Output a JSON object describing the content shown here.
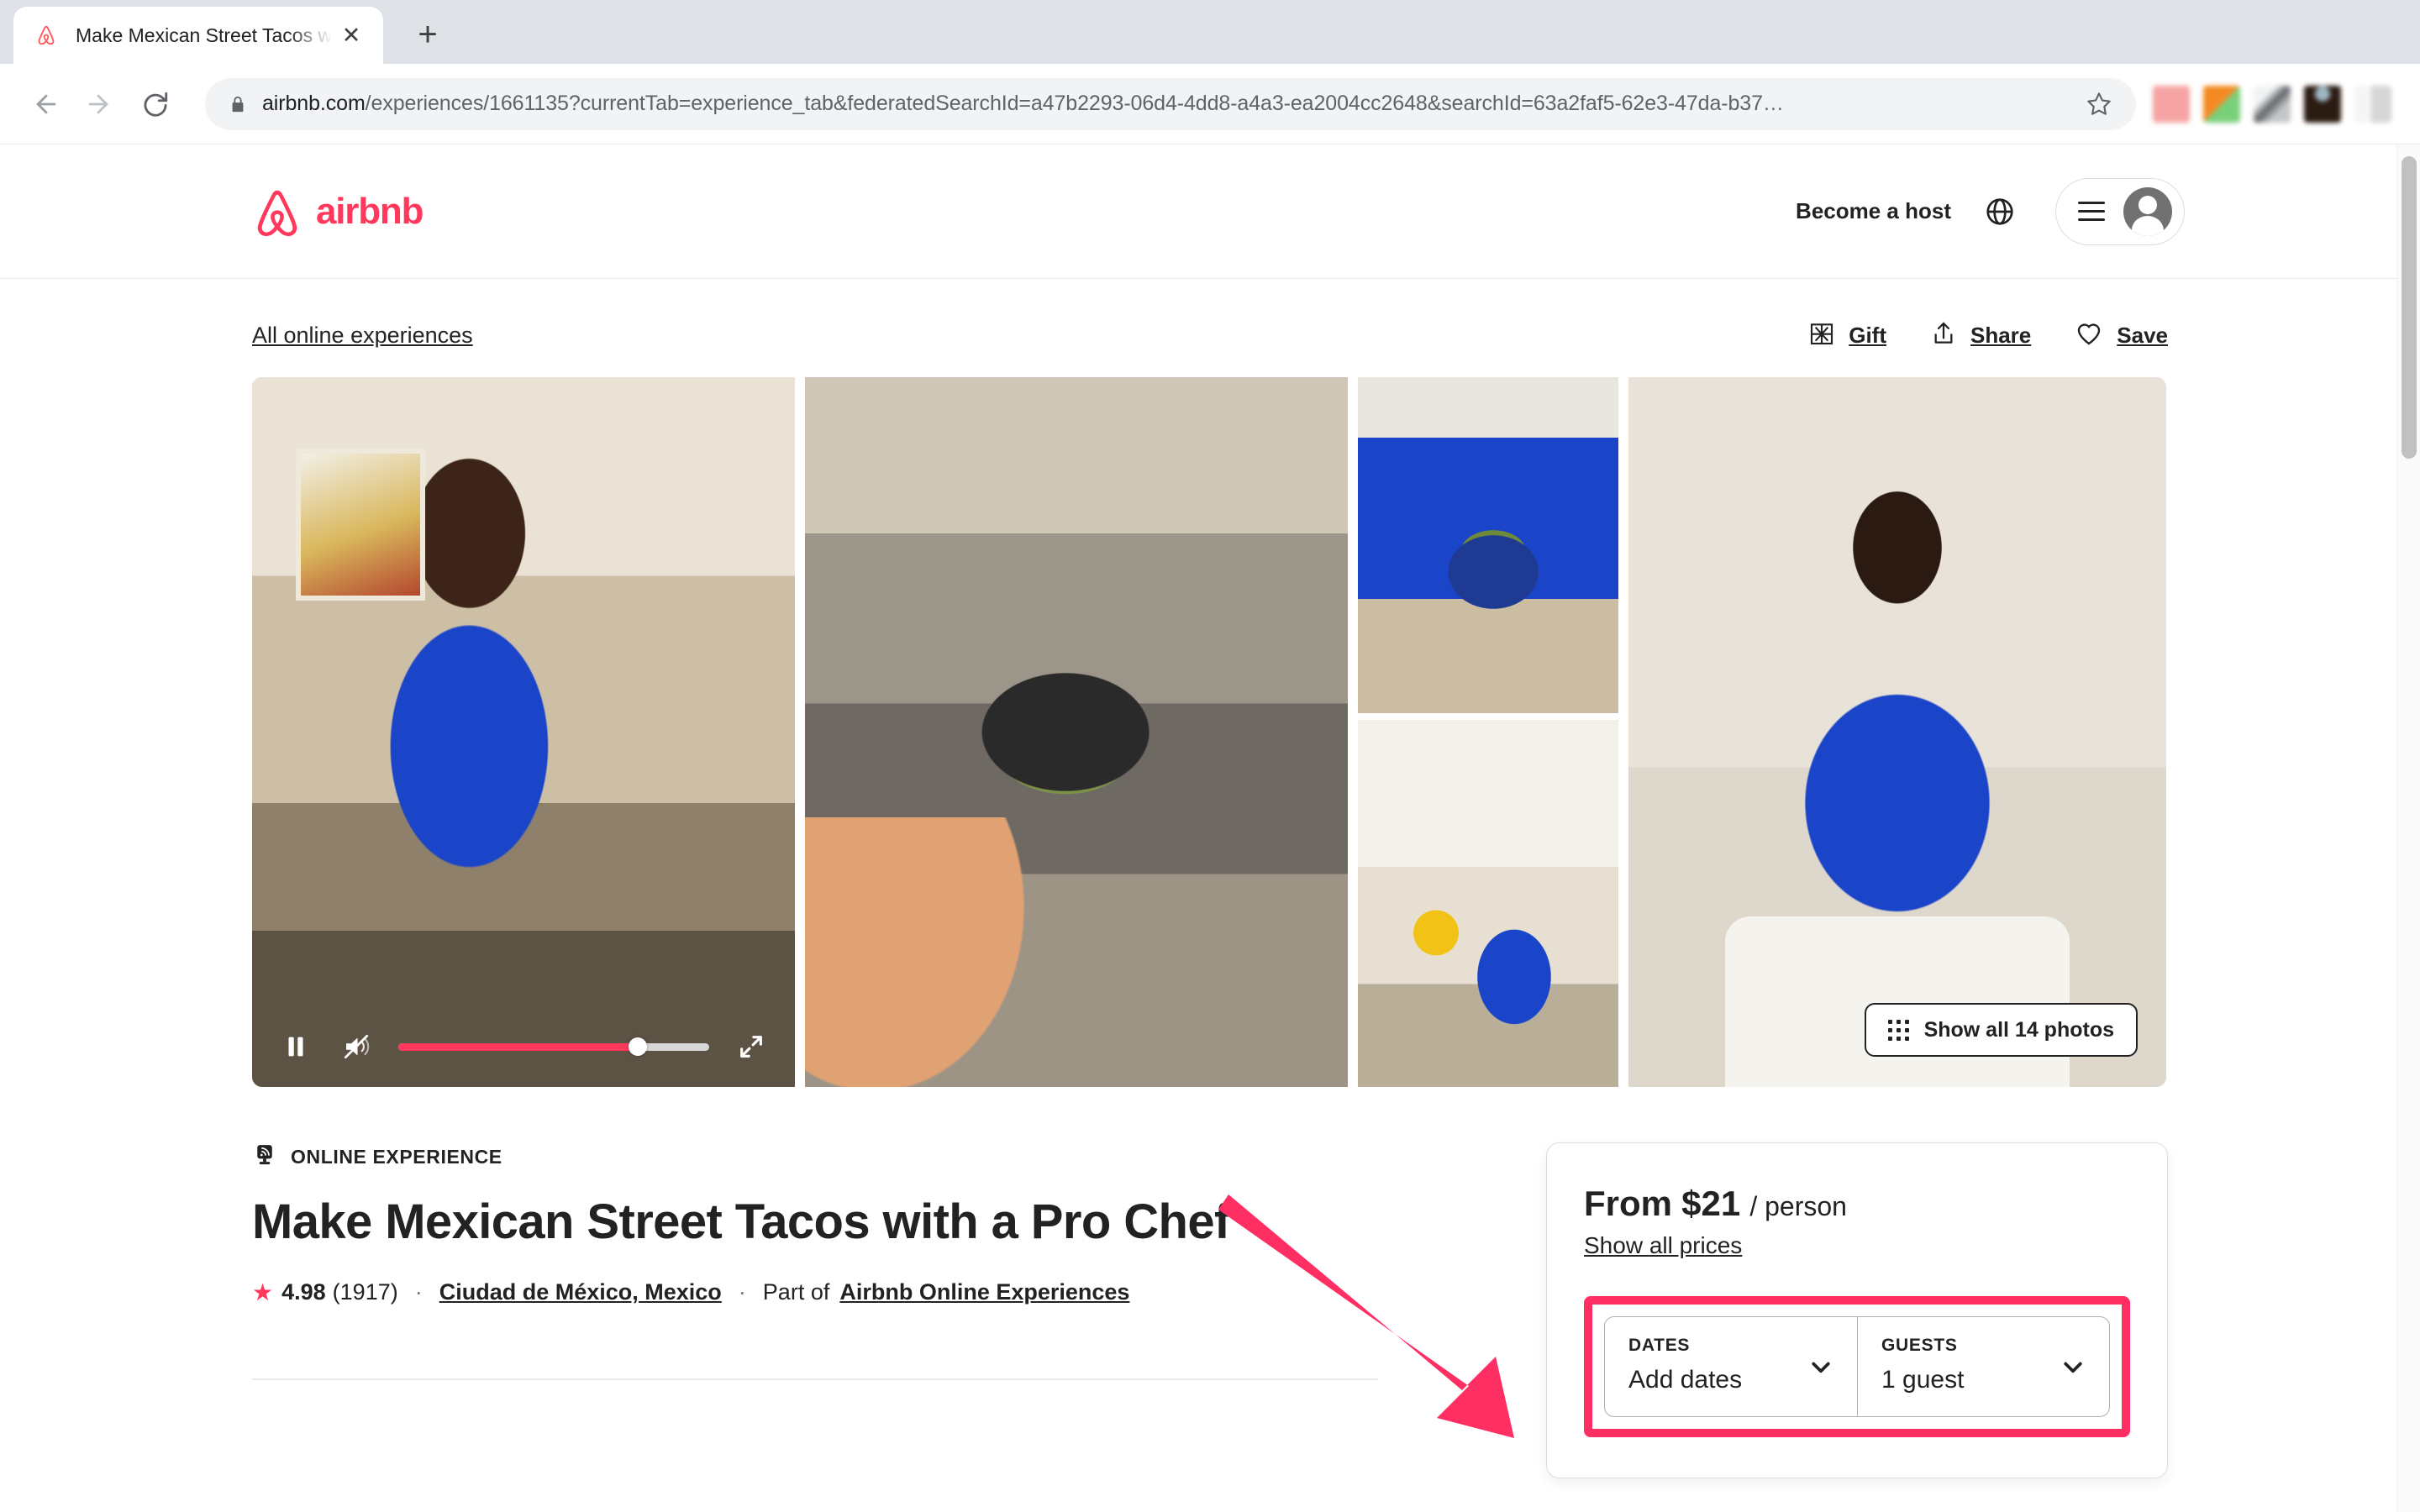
{
  "browser": {
    "tab": {
      "title": "Make Mexican Street Tacos wit",
      "favicon": "airbnb-favicon",
      "close_label": "✕"
    },
    "new_tab_label": "+",
    "nav": {
      "back": "←",
      "forward": "→",
      "reload": "↻"
    },
    "omnibox": {
      "host": "airbnb.com",
      "path": "/experiences/1661135?currentTab=experience_tab&federatedSearchId=a47b2293-06d4-4dd8-a4a3-ea2004cc2648&searchId=63a2faf5-62e3-47da-b37…",
      "lock": "lock-icon",
      "bookmark": "star-icon"
    }
  },
  "site_header": {
    "brand": "airbnb",
    "become_host": "Become a host",
    "globe": "globe-icon",
    "menu": "hamburger-icon",
    "avatar": "user-avatar"
  },
  "utility_row": {
    "breadcrumb": "All online experiences",
    "actions": [
      {
        "label": "Gift",
        "icon": "gift-icon"
      },
      {
        "label": "Share",
        "icon": "share-icon"
      },
      {
        "label": "Save",
        "icon": "heart-icon"
      }
    ]
  },
  "gallery": {
    "show_all_label": "Show all 14 photos",
    "show_all_icon": "grid-icon",
    "video_controls": {
      "play_pause": "pause-icon",
      "mute": "muted-volume-icon",
      "fullscreen": "expand-icon",
      "progress_percent": 77
    },
    "photos": [
      {
        "alt": "Chef cooking in kitchen (video)"
      },
      {
        "alt": "Pan of sauteed vegetables on stove"
      },
      {
        "alt": "Hands holding bowl of tacos"
      },
      {
        "alt": "Chef smiling with sunflowers"
      },
      {
        "alt": "Chef portrait holding molcajete"
      }
    ]
  },
  "listing": {
    "badge": "ONLINE EXPERIENCE",
    "badge_icon": "online-experience-icon",
    "title": "Make Mexican Street Tacos with a Pro Chef",
    "rating": "4.98",
    "review_count": "(1917)",
    "location": "Ciudad de México, Mexico",
    "part_of_prefix": "Part of",
    "part_of_link": "Airbnb Online Experiences",
    "star_icon": "star-icon",
    "separator": "·"
  },
  "booking": {
    "price_prefix": "From",
    "price": "$21",
    "price_unit": "/ person",
    "show_all_prices": "Show all prices",
    "fields": [
      {
        "label": "DATES",
        "value": "Add dates",
        "chevron": "chevron-down-icon"
      },
      {
        "label": "GUESTS",
        "value": "1 guest",
        "chevron": "chevron-down-icon"
      }
    ]
  },
  "annotation": {
    "arrow": "pink-pointer-arrow",
    "highlight": "pink-highlight-box",
    "color": "#FF2E63"
  },
  "colors": {
    "brand": "#FF385C",
    "annotation": "#FF2E63",
    "text": "#222222",
    "muted": "#717171"
  }
}
